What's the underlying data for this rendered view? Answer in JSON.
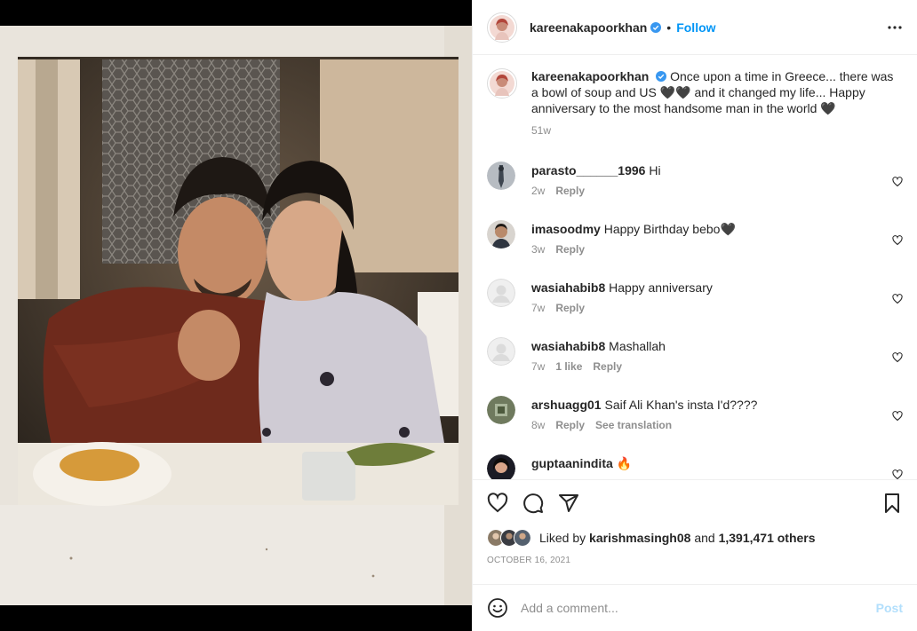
{
  "post": {
    "username": "kareenakapoorkhan",
    "follow_label": "Follow",
    "dot": "•",
    "caption": "Once upon a time in Greece... there was a bowl of soup and US 🖤🖤 and it changed my life... Happy anniversary to the most handsome man in the world 🖤",
    "caption_time": "51w",
    "likes_prefix": "Liked by",
    "liked_by_user": "karishmasingh08",
    "likes_and": "and",
    "likes_count": "1,391,471 others",
    "date": "October 16, 2021"
  },
  "comments": [
    {
      "username": "parasto______1996",
      "text": "Hi",
      "time": "2w",
      "likes": "",
      "reply": "Reply"
    },
    {
      "username": "imasoodmy",
      "text": "Happy Birthday bebo🖤",
      "time": "3w",
      "likes": "",
      "reply": "Reply"
    },
    {
      "username": "wasiahabib8",
      "text": "Happy anniversary",
      "time": "7w",
      "likes": "",
      "reply": "Reply"
    },
    {
      "username": "wasiahabib8",
      "text": "Mashallah",
      "time": "7w",
      "likes": "1 like",
      "reply": "Reply"
    },
    {
      "username": "arshuagg01",
      "text": "Saif Ali Khan's insta I'd????",
      "time": "8w",
      "likes": "",
      "reply": "Reply",
      "extra": "See translation"
    },
    {
      "username": "guptaanindita",
      "text": "🔥",
      "time": "",
      "likes": "",
      "reply": ""
    }
  ],
  "add_comment": {
    "placeholder": "Add a comment...",
    "post_label": "Post"
  },
  "icons": {
    "more": "more-icon",
    "like": "heart-icon",
    "comment": "comment-icon",
    "share": "share-icon",
    "save": "bookmark-icon",
    "emoji": "emoji-icon",
    "verified": "verified-badge-icon"
  },
  "colors": {
    "accent": "#0095f6",
    "post_disabled": "#b2dffc",
    "muted": "#8e8e8e"
  }
}
